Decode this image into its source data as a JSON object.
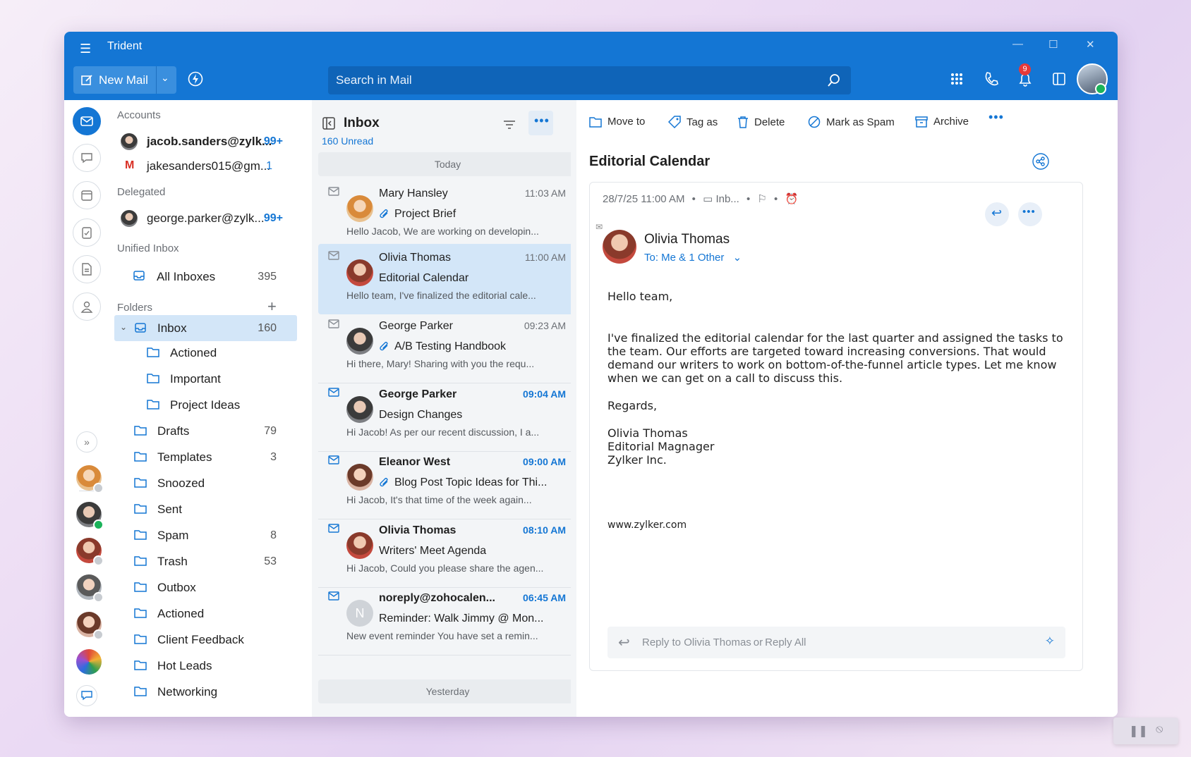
{
  "app": {
    "title": "Trident"
  },
  "header": {
    "new_mail_label": "New Mail",
    "search_placeholder": "Search in Mail",
    "notification_count": "9"
  },
  "accounts": {
    "section_label": "Accounts",
    "items": [
      {
        "name": "jacob.sanders@zylk...",
        "count": "99+"
      },
      {
        "name": "jakesanders015@gm...",
        "count": "1"
      }
    ]
  },
  "delegated": {
    "section_label": "Delegated",
    "items": [
      {
        "name": "george.parker@zylk...",
        "count": "99+"
      }
    ]
  },
  "unified": {
    "section_label": "Unified Inbox",
    "items": [
      {
        "name": "All Inboxes",
        "count": "395"
      }
    ]
  },
  "folders": {
    "section_label": "Folders",
    "items": [
      {
        "name": "Inbox",
        "count": "160"
      },
      {
        "name": "Actioned",
        "count": ""
      },
      {
        "name": "Important",
        "count": ""
      },
      {
        "name": "Project Ideas",
        "count": ""
      },
      {
        "name": "Drafts",
        "count": "79"
      },
      {
        "name": "Templates",
        "count": "3"
      },
      {
        "name": "Snoozed",
        "count": ""
      },
      {
        "name": "Sent",
        "count": ""
      },
      {
        "name": "Spam",
        "count": "8"
      },
      {
        "name": "Trash",
        "count": "53"
      },
      {
        "name": "Outbox",
        "count": ""
      },
      {
        "name": "Actioned",
        "count": ""
      },
      {
        "name": "Client Feedback",
        "count": ""
      },
      {
        "name": "Hot Leads",
        "count": ""
      },
      {
        "name": "Networking",
        "count": ""
      }
    ]
  },
  "list": {
    "title": "Inbox",
    "unread": "160 Unread",
    "day_today": "Today",
    "day_yesterday": "Yesterday",
    "mails": [
      {
        "sender": "Mary Hansley",
        "time": "11:03 AM",
        "subject": "Project Brief",
        "preview": "Hello Jacob, We are working on developin..."
      },
      {
        "sender": "Olivia Thomas",
        "time": "11:00 AM",
        "subject": "Editorial Calendar",
        "preview": "Hello team, I've finalized the editorial cale..."
      },
      {
        "sender": "George Parker",
        "time": "09:23 AM",
        "subject": "A/B Testing Handbook",
        "preview": "Hi there, Mary! Sharing with you the requ..."
      },
      {
        "sender": "George Parker",
        "time": "09:04 AM",
        "subject": "Design Changes",
        "preview": "Hi Jacob! As per our recent discussion, I a..."
      },
      {
        "sender": "Eleanor West",
        "time": "09:00 AM",
        "subject": "Blog Post Topic Ideas for Thi...",
        "preview": "Hi Jacob, It's that time of the week again..."
      },
      {
        "sender": "Olivia Thomas",
        "time": "08:10 AM",
        "subject": "Writers' Meet Agenda",
        "preview": "Hi Jacob, Could you please share the agen..."
      },
      {
        "sender": "noreply@zohocalen...",
        "time": "06:45 AM",
        "subject": "Reminder: Walk Jimmy @ Mon...",
        "preview": "New event reminder You have set a remin...",
        "initial": "N"
      }
    ]
  },
  "toolbar": {
    "move_to": "Move to",
    "tag_as": "Tag as",
    "delete": "Delete",
    "mark_spam": "Mark as Spam",
    "archive": "Archive"
  },
  "reader": {
    "subject": "Editorial Calendar",
    "date": "28/7/25 11:00 AM",
    "folder": "Inb...",
    "sender": "Olivia Thomas",
    "to": "To: Me & 1 Other",
    "greeting": "Hello team,",
    "paragraph": "I've finalized the editorial calendar for the last quarter and assigned the tasks to the team. Our efforts are targeted toward increasing conversions. That would demand our writers to work on bottom-of-the-funnel article types. Let me know when we can get on a call to discuss this.",
    "regards": "Regards,",
    "sig_name": "Olivia Thomas",
    "sig_title": "Editorial Magnager",
    "sig_company": "Zylker Inc.",
    "website": "www.zylker.com",
    "reply_to": "Reply to Olivia Thomas",
    "reply_or": "or",
    "reply_all": "Reply All"
  }
}
